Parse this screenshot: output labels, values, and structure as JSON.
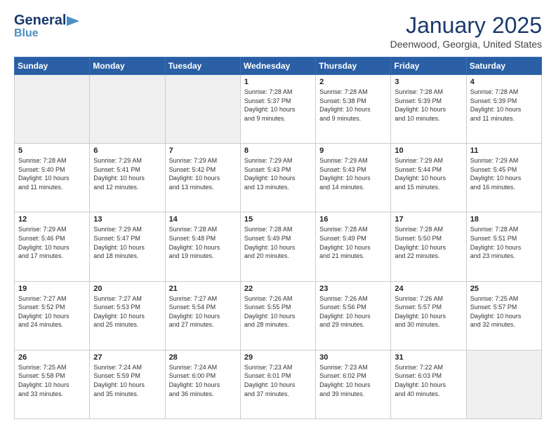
{
  "logo": {
    "general": "General",
    "blue": "Blue"
  },
  "title": "January 2025",
  "location": "Deenwood, Georgia, United States",
  "weekdays": [
    "Sunday",
    "Monday",
    "Tuesday",
    "Wednesday",
    "Thursday",
    "Friday",
    "Saturday"
  ],
  "weeks": [
    [
      {
        "day": "",
        "info": ""
      },
      {
        "day": "",
        "info": ""
      },
      {
        "day": "",
        "info": ""
      },
      {
        "day": "1",
        "info": "Sunrise: 7:28 AM\nSunset: 5:37 PM\nDaylight: 10 hours\nand 9 minutes."
      },
      {
        "day": "2",
        "info": "Sunrise: 7:28 AM\nSunset: 5:38 PM\nDaylight: 10 hours\nand 9 minutes."
      },
      {
        "day": "3",
        "info": "Sunrise: 7:28 AM\nSunset: 5:39 PM\nDaylight: 10 hours\nand 10 minutes."
      },
      {
        "day": "4",
        "info": "Sunrise: 7:28 AM\nSunset: 5:39 PM\nDaylight: 10 hours\nand 11 minutes."
      }
    ],
    [
      {
        "day": "5",
        "info": "Sunrise: 7:28 AM\nSunset: 5:40 PM\nDaylight: 10 hours\nand 11 minutes."
      },
      {
        "day": "6",
        "info": "Sunrise: 7:29 AM\nSunset: 5:41 PM\nDaylight: 10 hours\nand 12 minutes."
      },
      {
        "day": "7",
        "info": "Sunrise: 7:29 AM\nSunset: 5:42 PM\nDaylight: 10 hours\nand 13 minutes."
      },
      {
        "day": "8",
        "info": "Sunrise: 7:29 AM\nSunset: 5:43 PM\nDaylight: 10 hours\nand 13 minutes."
      },
      {
        "day": "9",
        "info": "Sunrise: 7:29 AM\nSunset: 5:43 PM\nDaylight: 10 hours\nand 14 minutes."
      },
      {
        "day": "10",
        "info": "Sunrise: 7:29 AM\nSunset: 5:44 PM\nDaylight: 10 hours\nand 15 minutes."
      },
      {
        "day": "11",
        "info": "Sunrise: 7:29 AM\nSunset: 5:45 PM\nDaylight: 10 hours\nand 16 minutes."
      }
    ],
    [
      {
        "day": "12",
        "info": "Sunrise: 7:29 AM\nSunset: 5:46 PM\nDaylight: 10 hours\nand 17 minutes."
      },
      {
        "day": "13",
        "info": "Sunrise: 7:29 AM\nSunset: 5:47 PM\nDaylight: 10 hours\nand 18 minutes."
      },
      {
        "day": "14",
        "info": "Sunrise: 7:28 AM\nSunset: 5:48 PM\nDaylight: 10 hours\nand 19 minutes."
      },
      {
        "day": "15",
        "info": "Sunrise: 7:28 AM\nSunset: 5:49 PM\nDaylight: 10 hours\nand 20 minutes."
      },
      {
        "day": "16",
        "info": "Sunrise: 7:28 AM\nSunset: 5:49 PM\nDaylight: 10 hours\nand 21 minutes."
      },
      {
        "day": "17",
        "info": "Sunrise: 7:28 AM\nSunset: 5:50 PM\nDaylight: 10 hours\nand 22 minutes."
      },
      {
        "day": "18",
        "info": "Sunrise: 7:28 AM\nSunset: 5:51 PM\nDaylight: 10 hours\nand 23 minutes."
      }
    ],
    [
      {
        "day": "19",
        "info": "Sunrise: 7:27 AM\nSunset: 5:52 PM\nDaylight: 10 hours\nand 24 minutes."
      },
      {
        "day": "20",
        "info": "Sunrise: 7:27 AM\nSunset: 5:53 PM\nDaylight: 10 hours\nand 25 minutes."
      },
      {
        "day": "21",
        "info": "Sunrise: 7:27 AM\nSunset: 5:54 PM\nDaylight: 10 hours\nand 27 minutes."
      },
      {
        "day": "22",
        "info": "Sunrise: 7:26 AM\nSunset: 5:55 PM\nDaylight: 10 hours\nand 28 minutes."
      },
      {
        "day": "23",
        "info": "Sunrise: 7:26 AM\nSunset: 5:56 PM\nDaylight: 10 hours\nand 29 minutes."
      },
      {
        "day": "24",
        "info": "Sunrise: 7:26 AM\nSunset: 5:57 PM\nDaylight: 10 hours\nand 30 minutes."
      },
      {
        "day": "25",
        "info": "Sunrise: 7:25 AM\nSunset: 5:57 PM\nDaylight: 10 hours\nand 32 minutes."
      }
    ],
    [
      {
        "day": "26",
        "info": "Sunrise: 7:25 AM\nSunset: 5:58 PM\nDaylight: 10 hours\nand 33 minutes."
      },
      {
        "day": "27",
        "info": "Sunrise: 7:24 AM\nSunset: 5:59 PM\nDaylight: 10 hours\nand 35 minutes."
      },
      {
        "day": "28",
        "info": "Sunrise: 7:24 AM\nSunset: 6:00 PM\nDaylight: 10 hours\nand 36 minutes."
      },
      {
        "day": "29",
        "info": "Sunrise: 7:23 AM\nSunset: 6:01 PM\nDaylight: 10 hours\nand 37 minutes."
      },
      {
        "day": "30",
        "info": "Sunrise: 7:23 AM\nSunset: 6:02 PM\nDaylight: 10 hours\nand 39 minutes."
      },
      {
        "day": "31",
        "info": "Sunrise: 7:22 AM\nSunset: 6:03 PM\nDaylight: 10 hours\nand 40 minutes."
      },
      {
        "day": "",
        "info": ""
      }
    ]
  ]
}
